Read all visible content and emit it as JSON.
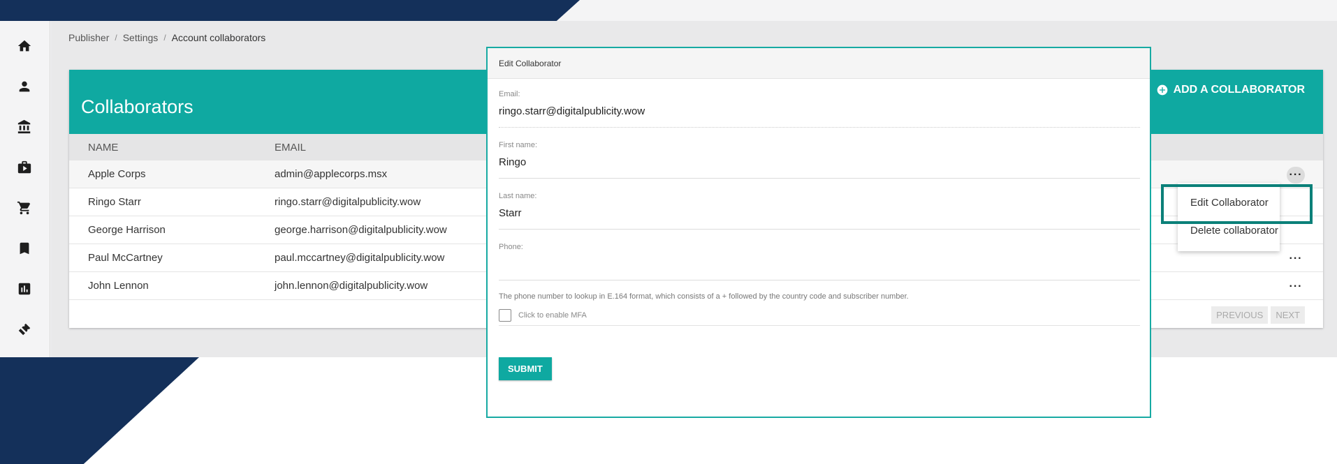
{
  "breadcrumb": [
    "Publisher",
    "Settings",
    "Account collaborators"
  ],
  "card": {
    "title": "Collaborators",
    "add_label": "ADD A COLLABORATOR"
  },
  "table": {
    "headers": [
      "NAME",
      "EMAIL"
    ],
    "rows": [
      {
        "name": "Apple Corps",
        "email": "admin@applecorps.msx"
      },
      {
        "name": "Ringo Starr",
        "email": "ringo.starr@digitalpublicity.wow"
      },
      {
        "name": "George Harrison",
        "email": "george.harrison@digitalpublicity.wow"
      },
      {
        "name": "Paul McCartney",
        "email": "paul.mccartney@digitalpublicity.wow"
      },
      {
        "name": "John Lennon",
        "email": "john.lennon@digitalpublicity.wow"
      }
    ],
    "menu_label": "···",
    "pager": {
      "previous": "PREVIOUS",
      "next": "NEXT"
    }
  },
  "dropdown": {
    "items": [
      "Edit Collaborator",
      "Delete collaborator"
    ]
  },
  "modal": {
    "title": "Edit Collaborator",
    "fields": [
      {
        "label": "Email:",
        "value": "ringo.starr@digitalpublicity.wow"
      },
      {
        "label": "First name:",
        "value": "Ringo"
      },
      {
        "label": "Last name:",
        "value": "Starr"
      },
      {
        "label": "Phone:",
        "value": ""
      }
    ],
    "phone_hint": "The phone number to lookup in E.164 format, which consists of a + followed by the country code and subscriber number.",
    "mfa_label": "Click to enable MFA",
    "submit_label": "SUBMIT"
  },
  "colors": {
    "teal": "#0fa9a1",
    "navy": "#14305a",
    "highlight": "#0b8079"
  },
  "icons": [
    "home-icon",
    "person-icon",
    "bank-icon",
    "briefcase-play-icon",
    "cart-icon",
    "bookmark-icon",
    "chart-icon",
    "ticket-icon",
    "plus-circle-icon"
  ]
}
